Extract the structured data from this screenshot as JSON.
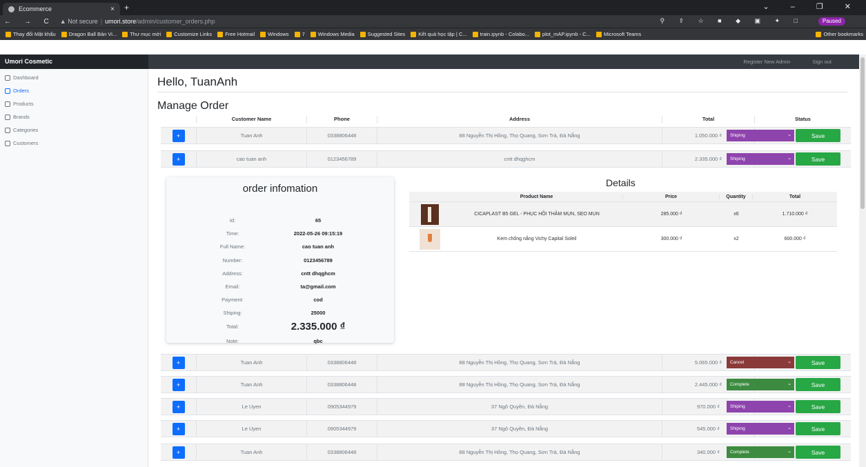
{
  "browser": {
    "tab_title": "Ecommerce",
    "tab_close": "×",
    "new_tab": "+",
    "window_controls": "⌄ – ❐ ✕",
    "nav_buttons": "← → C",
    "security": "▲ Not secure",
    "url_host": "umori.store",
    "url_path": "/admin/customer_orders.php",
    "toolbar_icons": "⚲ ⇪ ☆ ■ ◆ ▣ ✦ □",
    "profile": "Paused",
    "bookmarks": [
      "Thay đổi Mật khẩu",
      "Dragon Ball Bản Vi...",
      "Thư mục mới",
      "Customize Links",
      "Free Hotmail",
      "Windows",
      "7",
      "Windows Media",
      "Suggested Sites",
      "Kết quả học tập | C...",
      "train.ipynb - Colabo...",
      "plot_mAP.ipynb - C...",
      "Microsoft Teams"
    ],
    "other_bookmarks": "Other bookmarks"
  },
  "app": {
    "brand": "Umori Cosmetic",
    "register": "Register New Admin",
    "signout": "Sign out"
  },
  "sidebar": {
    "items": [
      {
        "label": "Dashboard",
        "icon": "home-icon"
      },
      {
        "label": "Orders",
        "icon": "file-icon"
      },
      {
        "label": "Products",
        "icon": "cart-icon"
      },
      {
        "label": "Brands",
        "icon": "tag-icon"
      },
      {
        "label": "Categories",
        "icon": "layers-icon"
      },
      {
        "label": "Customers",
        "icon": "users-icon"
      }
    ]
  },
  "main": {
    "hello": "Hello, TuanAnh",
    "manage": "Manage Order",
    "headers": [
      "",
      "Customer Name",
      "Phone",
      "Address",
      "Total",
      "Status"
    ],
    "plus": "+",
    "save": "Save",
    "chevron": "⌄",
    "rows": [
      {
        "name": "Tuan Anh",
        "phone": "0338806448",
        "address": "88 Nguyễn Thị Hồng, Thọ Quang, Sơn Trà, Đà Nẵng",
        "total": "1.050.000 ₫",
        "status": "Shiping",
        "color": "#8e44ad"
      },
      {
        "name": "cao tuan anh",
        "phone": "0123456789",
        "address": "cntt dhqghcm",
        "total": "2.335.000 ₫",
        "status": "Shiping",
        "color": "#8e44ad"
      },
      {
        "name": "Tuan Anh",
        "phone": "0338806448",
        "address": "88 Nguyễn Thị Hồng, Thọ Quang, Sơn Trà, Đà Nẵng",
        "total": "5.065.000 ₫",
        "status": "Cancel",
        "color": "#8b3a3a"
      },
      {
        "name": "Tuan Anh",
        "phone": "0338806448",
        "address": "88 Nguyễn Thị Hồng, Thọ Quang, Sơn Trà, Đà Nẵng",
        "total": "2.445.000 ₫",
        "status": "Complete",
        "color": "#3d8b40"
      },
      {
        "name": "Le Uyen",
        "phone": "0905344979",
        "address": "37 Ngô Quyền, Đà Nẵng",
        "total": "970.000 ₫",
        "status": "Shiping",
        "color": "#8e44ad"
      },
      {
        "name": "Le Uyen",
        "phone": "0905344979",
        "address": "37 Ngô Quyền, Đà Nẵng",
        "total": "545.000 ₫",
        "status": "Shiping",
        "color": "#8e44ad"
      },
      {
        "name": "Tuan Anh",
        "phone": "0338806448",
        "address": "88 Nguyễn Thị Hồng, Thọ Quang, Sơn Trà, Đà Nẵng",
        "total": "340.000 ₫",
        "status": "Complete",
        "color": "#3d8b40"
      }
    ]
  },
  "order_info": {
    "title": "order infomation",
    "fields": [
      {
        "k": "Id:",
        "v": "65"
      },
      {
        "k": "Time:",
        "v": "2022-05-26 09:15:19"
      },
      {
        "k": "Full Name:",
        "v": "cao tuan anh"
      },
      {
        "k": "Number:",
        "v": "0123456789"
      },
      {
        "k": "Address:",
        "v": "cntt dhqghcm"
      },
      {
        "k": "Email:",
        "v": "ta@gmail.com"
      },
      {
        "k": "Payment:",
        "v": "cod"
      },
      {
        "k": "Shiping:",
        "v": "25000"
      },
      {
        "k": "Total:",
        "v": "2.335.000 ₫"
      },
      {
        "k": "Note:",
        "v": "qbc"
      }
    ]
  },
  "details": {
    "title": "Details",
    "headers": [
      "",
      "Product Name",
      "Price",
      "Quantity",
      "Total"
    ],
    "rows": [
      {
        "name": "CICAPLAST B5 GEL - PHỤC HỒI THÂM MỤN, SẸO MỤN",
        "price": "285.000 ₫",
        "qty": "x6",
        "total": "1.710.000 ₫"
      },
      {
        "name": "Kem chống nắng Vichy Capital Soleil",
        "price": "300.000 ₫",
        "qty": "x2",
        "total": "600.000 ₫"
      }
    ]
  }
}
